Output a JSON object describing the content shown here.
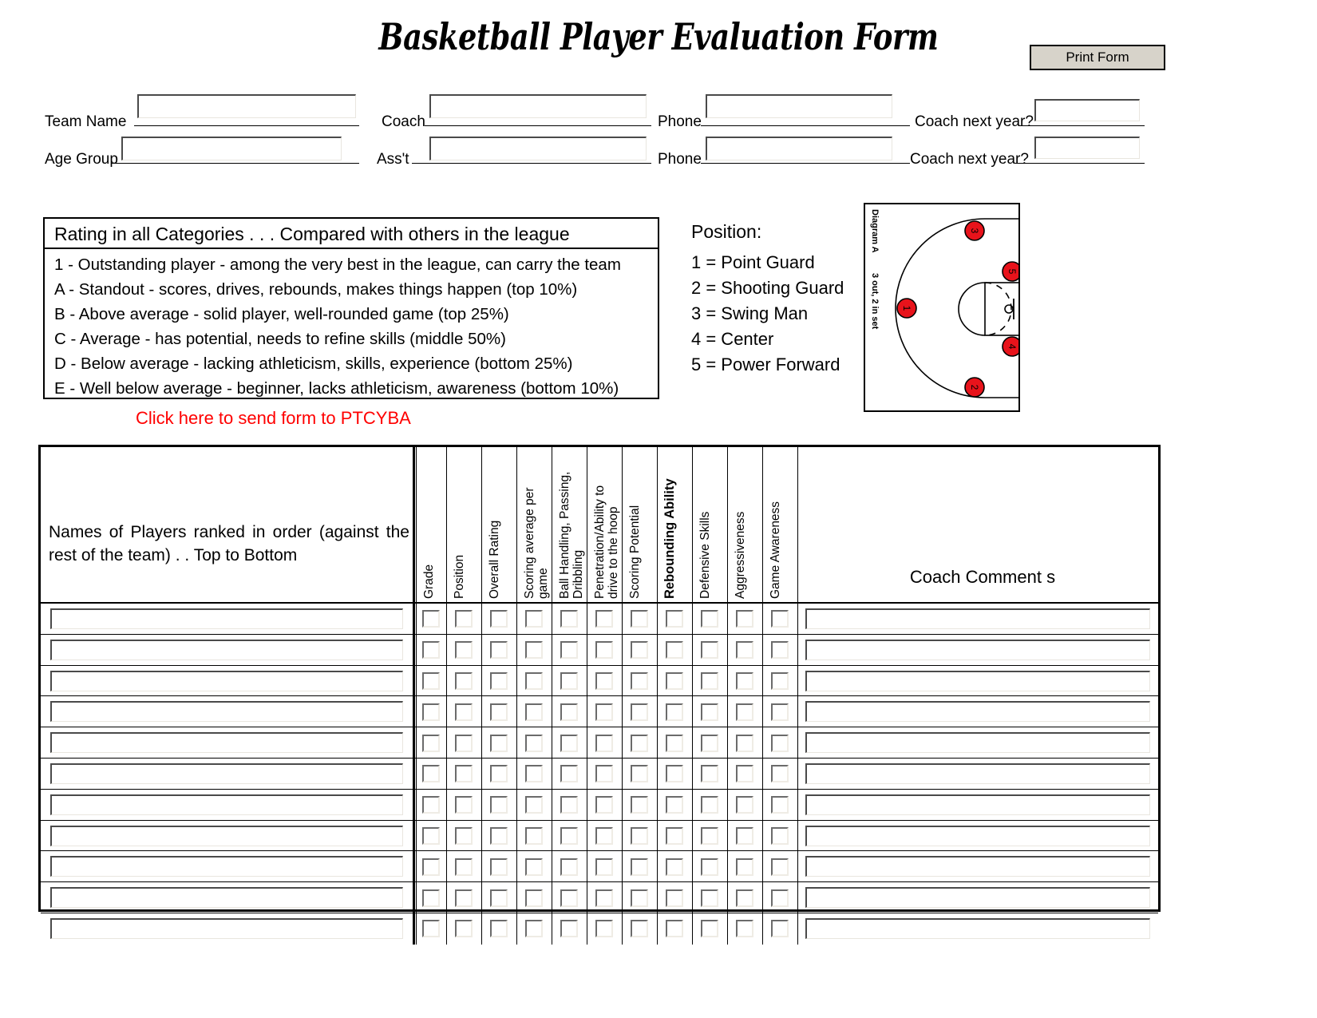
{
  "page": {
    "title": "Basketball Player Evaluation Form",
    "print_button_label": "Print Form"
  },
  "header_fields": {
    "row1": [
      {
        "label": "Team Name",
        "value": "",
        "placeholder": ""
      },
      {
        "label": "Coach",
        "value": "",
        "placeholder": ""
      },
      {
        "label": "Phone",
        "value": "",
        "placeholder": ""
      },
      {
        "label": "Coach next year?",
        "value": "",
        "placeholder": ""
      }
    ],
    "row2": [
      {
        "label": "Age Group",
        "value": "",
        "placeholder": ""
      },
      {
        "label": "Ass't",
        "value": "",
        "placeholder": ""
      },
      {
        "label": "Phone",
        "value": "",
        "placeholder": ""
      },
      {
        "label": "Coach next year?",
        "value": "",
        "placeholder": ""
      }
    ]
  },
  "rating_legend": {
    "title": "Rating in all Categories . . . Compared with others in the league",
    "lines": [
      "1 - Outstanding player - among the very best in the league, can carry the team",
      "A - Standout - scores, drives, rebounds, makes things happen (top 10%)",
      "B - Above average - solid player, well-rounded game (top 25%)",
      "C - Average - has potential, needs to refine skills (middle 50%)",
      "D - Below average - lacking athleticism, skills, experience (bottom 25%)",
      "E - Well below average - beginner, lacks athleticism, awareness (bottom 10%)"
    ]
  },
  "position_legend": {
    "heading": "Position:",
    "items": [
      "1 = Point Guard",
      "2 = Shooting Guard",
      "3 = Swing Man",
      "4 = Center",
      "5 = Power Forward"
    ]
  },
  "court_diagram": {
    "caption_title": "Diagram A",
    "caption_sub": "3 out, 2 in set",
    "marker_color": "#e8131b",
    "players": [
      {
        "label": "3"
      },
      {
        "label": "5"
      },
      {
        "label": "1"
      },
      {
        "label": "4"
      },
      {
        "label": "2"
      }
    ]
  },
  "send_link": {
    "label": "Click here to send form to PTCYBA",
    "color": "#ff0000"
  },
  "player_table": {
    "names_header": "Names of Players ranked in order (against the rest of the team) . . Top to Bottom",
    "rating_columns": [
      {
        "label": "Grade",
        "bold": false
      },
      {
        "label": "Position",
        "bold": false
      },
      {
        "label": "Overall Rating",
        "bold": false
      },
      {
        "label": "Scoring average per game",
        "bold": false
      },
      {
        "label": "Ball Handling, Passing, Dribbling",
        "bold": false
      },
      {
        "label": "Penetration/Ability to drive to the hoop",
        "bold": false
      },
      {
        "label": "Scoring Potential",
        "bold": false
      },
      {
        "label": "Rebounding Ability",
        "bold": true
      },
      {
        "label": "Defensive Skills",
        "bold": false
      },
      {
        "label": "Aggressiveness",
        "bold": false
      },
      {
        "label": "Game Awareness",
        "bold": false
      }
    ],
    "comments_header": "Coach Comment s",
    "row_count": 11,
    "rows": [
      {
        "name": "",
        "ratings": [
          "",
          "",
          "",
          "",
          "",
          "",
          "",
          "",
          "",
          "",
          ""
        ],
        "comments": ""
      },
      {
        "name": "",
        "ratings": [
          "",
          "",
          "",
          "",
          "",
          "",
          "",
          "",
          "",
          "",
          ""
        ],
        "comments": ""
      },
      {
        "name": "",
        "ratings": [
          "",
          "",
          "",
          "",
          "",
          "",
          "",
          "",
          "",
          "",
          ""
        ],
        "comments": ""
      },
      {
        "name": "",
        "ratings": [
          "",
          "",
          "",
          "",
          "",
          "",
          "",
          "",
          "",
          "",
          ""
        ],
        "comments": ""
      },
      {
        "name": "",
        "ratings": [
          "",
          "",
          "",
          "",
          "",
          "",
          "",
          "",
          "",
          "",
          ""
        ],
        "comments": ""
      },
      {
        "name": "",
        "ratings": [
          "",
          "",
          "",
          "",
          "",
          "",
          "",
          "",
          "",
          "",
          ""
        ],
        "comments": ""
      },
      {
        "name": "",
        "ratings": [
          "",
          "",
          "",
          "",
          "",
          "",
          "",
          "",
          "",
          "",
          ""
        ],
        "comments": ""
      },
      {
        "name": "",
        "ratings": [
          "",
          "",
          "",
          "",
          "",
          "",
          "",
          "",
          "",
          "",
          ""
        ],
        "comments": ""
      },
      {
        "name": "",
        "ratings": [
          "",
          "",
          "",
          "",
          "",
          "",
          "",
          "",
          "",
          "",
          ""
        ],
        "comments": ""
      },
      {
        "name": "",
        "ratings": [
          "",
          "",
          "",
          "",
          "",
          "",
          "",
          "",
          "",
          "",
          ""
        ],
        "comments": ""
      },
      {
        "name": "",
        "ratings": [
          "",
          "",
          "",
          "",
          "",
          "",
          "",
          "",
          "",
          "",
          ""
        ],
        "comments": ""
      }
    ]
  }
}
